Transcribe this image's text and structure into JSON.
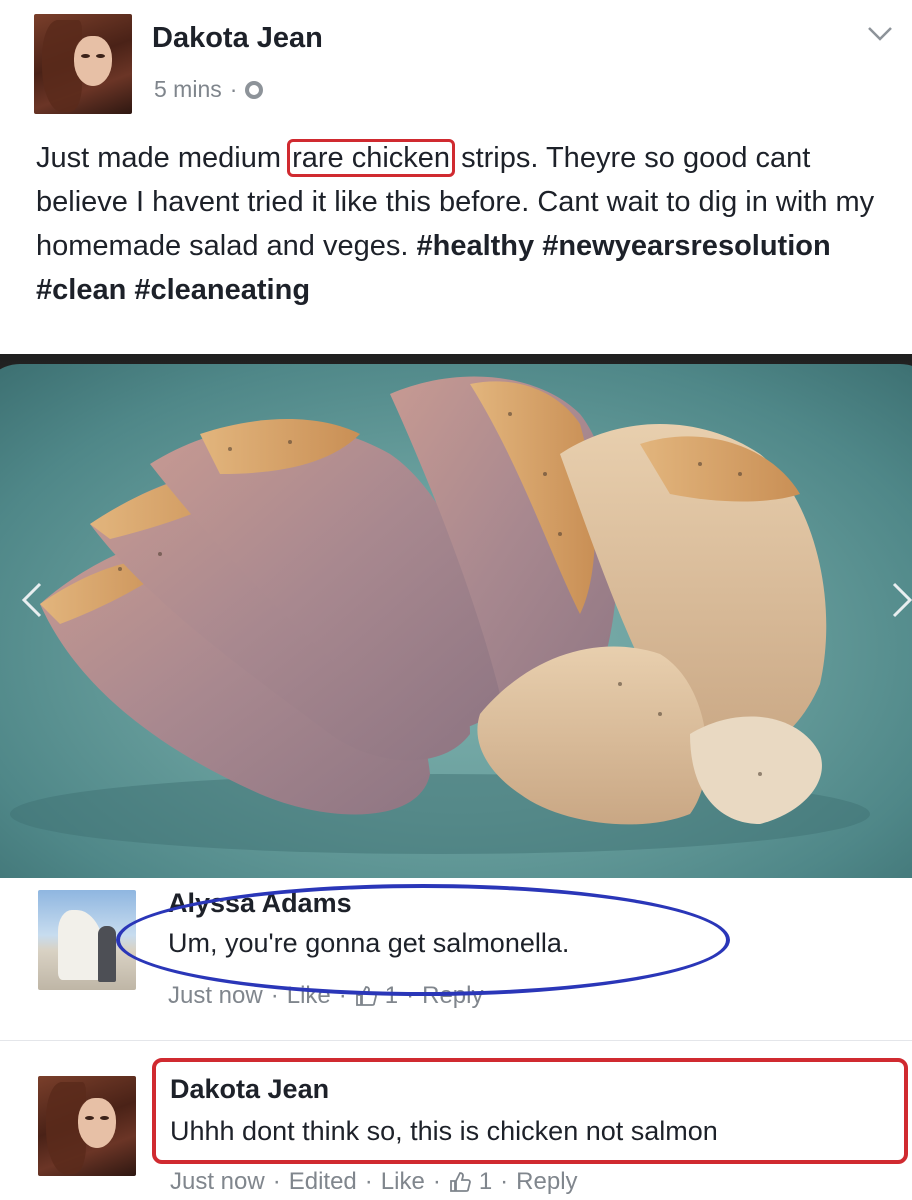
{
  "post": {
    "author": "Dakota Jean",
    "time": "5 mins",
    "meta_separator": "·",
    "privacy_icon": "globe-icon",
    "menu_icon": "chevron-down-icon",
    "text_before": "Just made medium",
    "text_highlight": "rare chicken",
    "text_after": "strips. Theyre so good cant believe I havent tried it like this before. Cant wait to dig in with my homemade salad and veges.",
    "hashtags": "#healthy #newyearsresolution #clean #cleaneating"
  },
  "photo": {
    "prev_icon": "chevron-left-icon",
    "next_icon": "chevron-right-icon"
  },
  "comments": [
    {
      "author": "Alyssa Adams",
      "text": "Um, you're gonna get salmonella.",
      "time": "Just now",
      "like": "Like",
      "reaction_count": "1",
      "reply": "Reply",
      "annotation_color": "#2a36b8"
    },
    {
      "author": "Dakota Jean",
      "text": "Uhhh dont think so, this is chicken not salmon",
      "time": "Just now",
      "edited": "Edited",
      "like": "Like",
      "reaction_count": "1",
      "reply": "Reply",
      "annotation_color": "#d02a30"
    }
  ],
  "colors": {
    "highlight_red": "#d02a30",
    "oval_blue": "#2a36b8",
    "meta_gray": "#7f858c"
  }
}
